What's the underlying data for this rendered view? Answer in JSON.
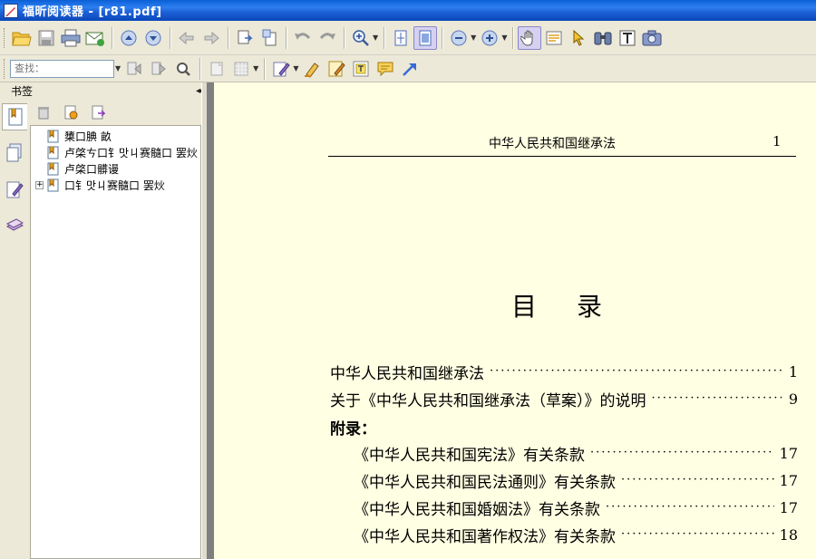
{
  "window": {
    "title": "福昕阅读器 - [r81.pdf]"
  },
  "toolbar_search": {
    "placeholder": "查找："
  },
  "left_panel": {
    "title": "书签",
    "collapse_glyph": "◂◂",
    "bookmarks": [
      {
        "label": "橥口腆  畝",
        "expandable": false
      },
      {
        "label": "卢棨ㄘ口钅맛ㄐ赛髓口  罢炏",
        "expandable": false
      },
      {
        "label": "卢棨口髒谩",
        "expandable": false
      },
      {
        "label": "口钅맛ㄐ赛髓口  罢炏",
        "expandable": true,
        "expander_glyph": "+"
      }
    ]
  },
  "document": {
    "running_header": "中华人民共和国继承法",
    "running_page_number": "1",
    "toc_title": "目录",
    "toc_entries": [
      {
        "text": "中华人民共和国继承法",
        "page": "1"
      },
      {
        "text": "关于《中华人民共和国继承法（草案）》的说明",
        "page": "9"
      }
    ],
    "appendix_label": "附录：",
    "appendix_entries": [
      {
        "text": "《中华人民共和国宪法》有关条款",
        "page": "17"
      },
      {
        "text": "《中华人民共和国民法通则》有关条款",
        "page": "17"
      },
      {
        "text": "《中华人民共和国婚姻法》有关条款",
        "page": "17"
      },
      {
        "text": "《中华人民共和国著作权法》有关条款",
        "page": "18"
      }
    ]
  },
  "colors": {
    "title_bar": "#0a5fd8",
    "page_background": "#ffffe3",
    "chrome": "#ece9d8"
  }
}
